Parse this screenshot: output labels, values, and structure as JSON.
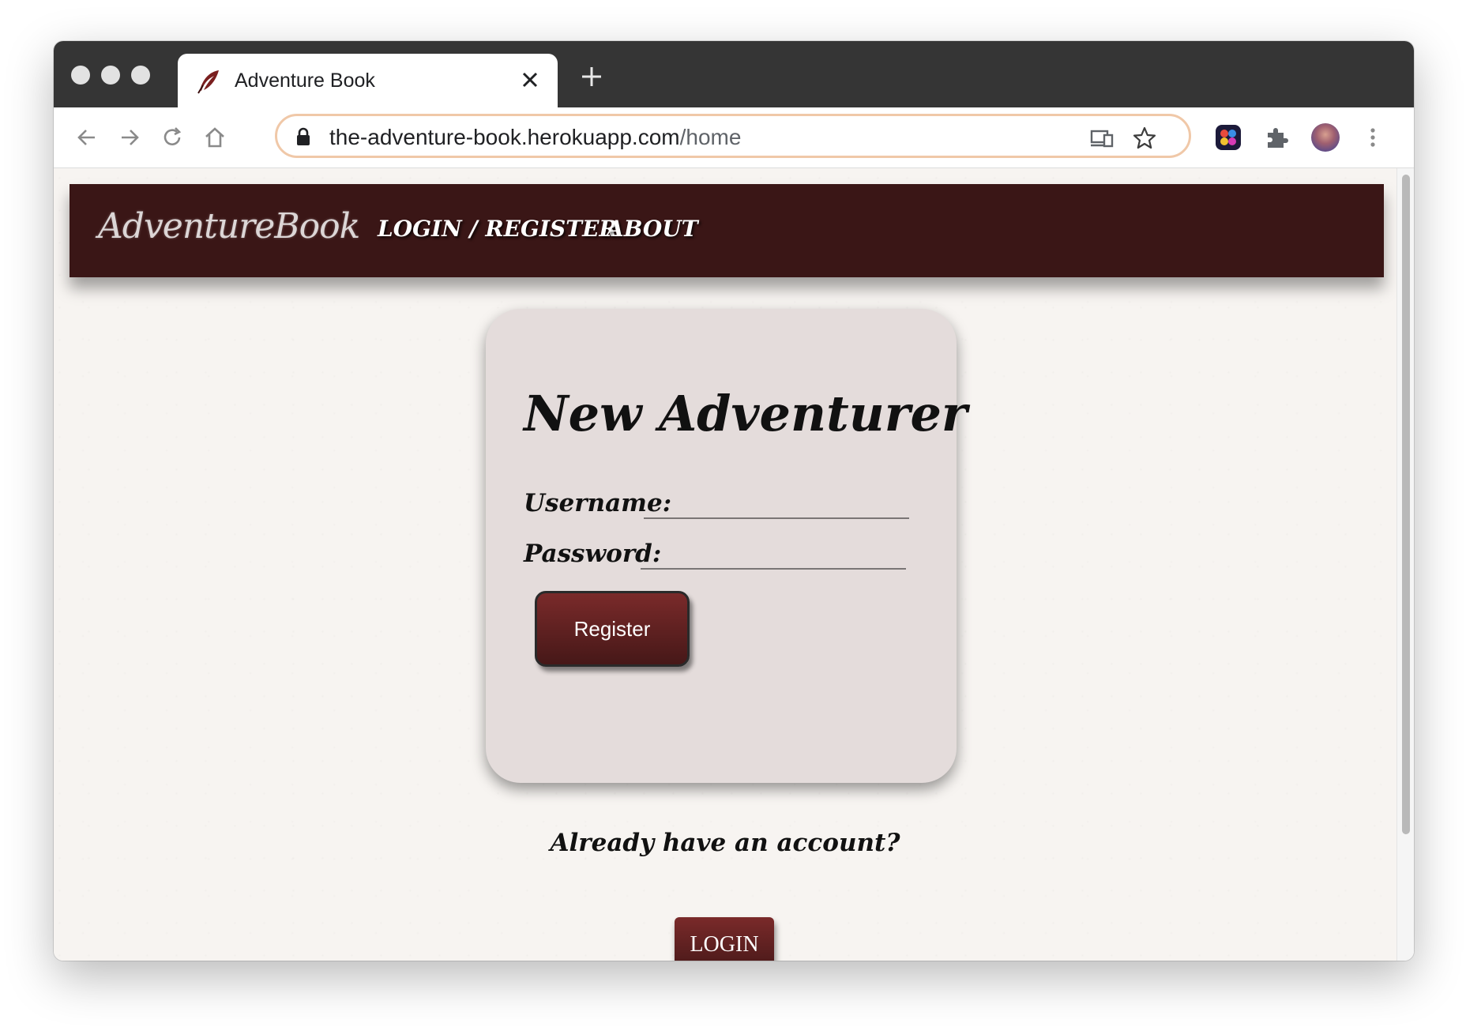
{
  "browser": {
    "tab": {
      "title": "Adventure Book",
      "favicon": "feather-icon"
    },
    "url": {
      "host": "the-adventure-book.herokuapp.com",
      "path": "/home"
    }
  },
  "site": {
    "logo": "AdventureBook",
    "nav": [
      {
        "label": "LOGIN / REGISTER"
      },
      {
        "label": "ABOUT"
      }
    ],
    "brand_color": "#3a1616"
  },
  "form": {
    "title": "New Adventurer",
    "username_label": "Username:",
    "username_value": "",
    "password_label": "Password:",
    "password_value": "",
    "register_label": "Register"
  },
  "footer": {
    "prompt": "Already have an account?",
    "login_label": "LOGIN"
  }
}
